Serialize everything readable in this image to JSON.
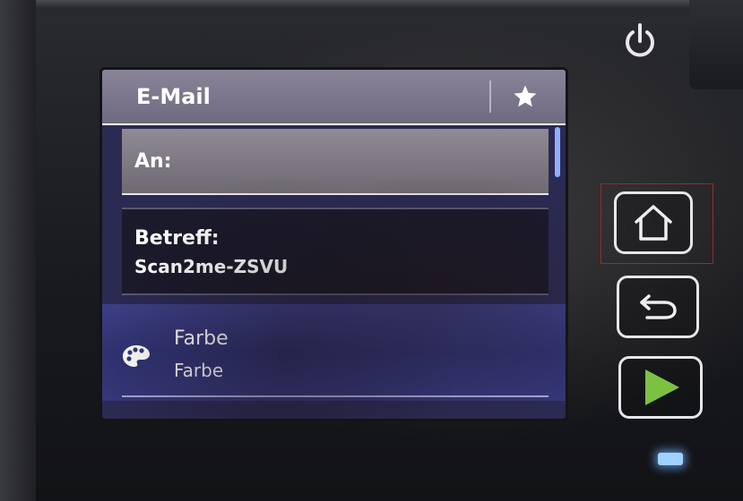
{
  "screen": {
    "title": "E-Mail",
    "fields": {
      "to_label": "An:",
      "subject_label": "Betreff:",
      "subject_value": "Scan2me-ZSVU"
    },
    "option": {
      "icon": "palette-icon",
      "title": "Farbe",
      "value": "Farbe"
    }
  },
  "hardware": {
    "buttons": [
      "power-icon",
      "home-icon",
      "back-icon",
      "start-icon"
    ],
    "start_color": "#7cc242"
  },
  "colors": {
    "title_bar": "#7a7590",
    "selected_field": "#1b1a2b",
    "option_row": "#34377a",
    "led": "#9fd2ff"
  }
}
